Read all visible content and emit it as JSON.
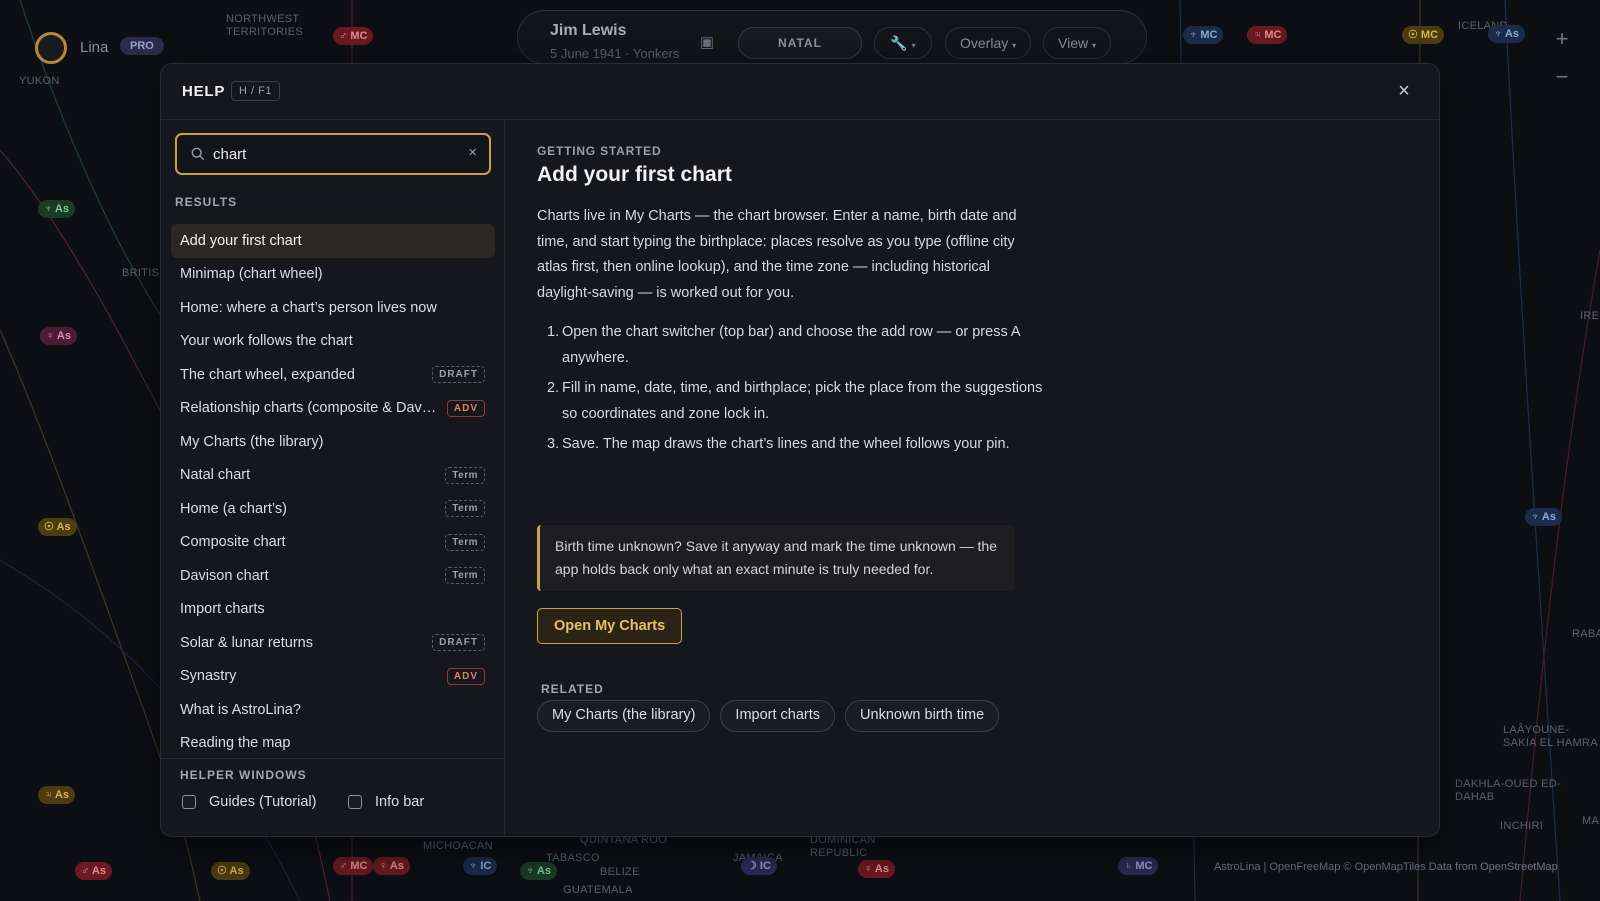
{
  "map": {
    "labels": [
      "NORTHWEST\nTERRITORIES",
      "YUKON",
      "BRITISH",
      "MICHOACAN",
      "QUINTANA ROO",
      "TABASCO",
      "BELIZE",
      "GUATEMALA",
      "JAMAICA",
      "DOMINICAN\nREPUBLIC",
      "ICELAND",
      "LAÂYOUNE-\nSAKIA EL HAMRA",
      "DAKHLA-OUED ED-DAHAB",
      "INCHIRI",
      "MAURI",
      "RABA",
      "IRE"
    ],
    "tags": [
      "MC",
      "MC",
      "MC",
      "MC",
      "MC",
      "As",
      "As",
      "As",
      "As",
      "As",
      "As",
      "As",
      "IC",
      "IC",
      "MC",
      "As",
      "As",
      "As",
      "As"
    ]
  },
  "app": {
    "user_name": "Lina",
    "plan_badge": "PRO",
    "chart_person": "Jim Lewis",
    "chart_subtitle": "5 June 1941 · Yonkers",
    "mode_button": "NATAL",
    "overlay_label": "Overlay",
    "view_label": "View",
    "zoom_in": "+",
    "zoom_out": "−",
    "attribution": "AstroLina | OpenFreeMap © OpenMapTiles Data from OpenStreetMap"
  },
  "help": {
    "title": "HELP",
    "shortcut": "H / F1",
    "close_label": "×",
    "search": {
      "value": "chart",
      "placeholder": "Search help",
      "clear_label": "×"
    },
    "results_label": "RESULTS",
    "results": [
      {
        "label": "Add your first chart",
        "badge": "",
        "active": true
      },
      {
        "label": "Minimap (chart wheel)",
        "badge": ""
      },
      {
        "label": "Home: where a chart’s person lives now",
        "badge": ""
      },
      {
        "label": "Your work follows the chart",
        "badge": ""
      },
      {
        "label": "The chart wheel, expanded",
        "badge": "DRAFT"
      },
      {
        "label": "Relationship charts (composite & Davison)",
        "badge": "ADV"
      },
      {
        "label": "My Charts (the library)",
        "badge": ""
      },
      {
        "label": "Natal chart",
        "badge": "Term"
      },
      {
        "label": "Home (a chart’s)",
        "badge": "Term"
      },
      {
        "label": "Composite chart",
        "badge": "Term"
      },
      {
        "label": "Davison chart",
        "badge": "Term"
      },
      {
        "label": "Import charts",
        "badge": ""
      },
      {
        "label": "Solar & lunar returns",
        "badge": "DRAFT"
      },
      {
        "label": "Synastry",
        "badge": "ADV"
      },
      {
        "label": "What is AstroLina?",
        "badge": ""
      },
      {
        "label": "Reading the map",
        "badge": ""
      }
    ],
    "helper_windows_label": "HELPER WINDOWS",
    "helper_windows": [
      {
        "label": "Guides (Tutorial)",
        "checked": false
      },
      {
        "label": "Info bar",
        "checked": false
      }
    ],
    "article": {
      "breadcrumb": "GETTING STARTED",
      "title": "Add your first chart",
      "intro": "Charts live in My Charts — the chart browser. Enter a name, birth date and time, and start typing the birthplace: places resolve as you type (offline city atlas first, then online lookup), and the time zone — including historical daylight-saving — is worked out for you.",
      "steps": [
        "Open the chart switcher (top bar) and choose the add row — or press A anywhere.",
        "Fill in name, date, time, and birthplace; pick the place from the suggestions so coordinates and zone lock in.",
        "Save. The map draws the chart’s lines and the wheel follows your pin."
      ],
      "tip": "Birth time unknown? Save it anyway and mark the time unknown — the app holds back only what an exact minute is truly needed for.",
      "primary_button": "Open My Charts",
      "related_label": "RELATED",
      "related": [
        "My Charts (the library)",
        "Import charts",
        "Unknown birth time"
      ]
    }
  },
  "colors": {
    "accent": "#c9a14e",
    "adv": "#e07b6e",
    "panel": "#15171d"
  }
}
